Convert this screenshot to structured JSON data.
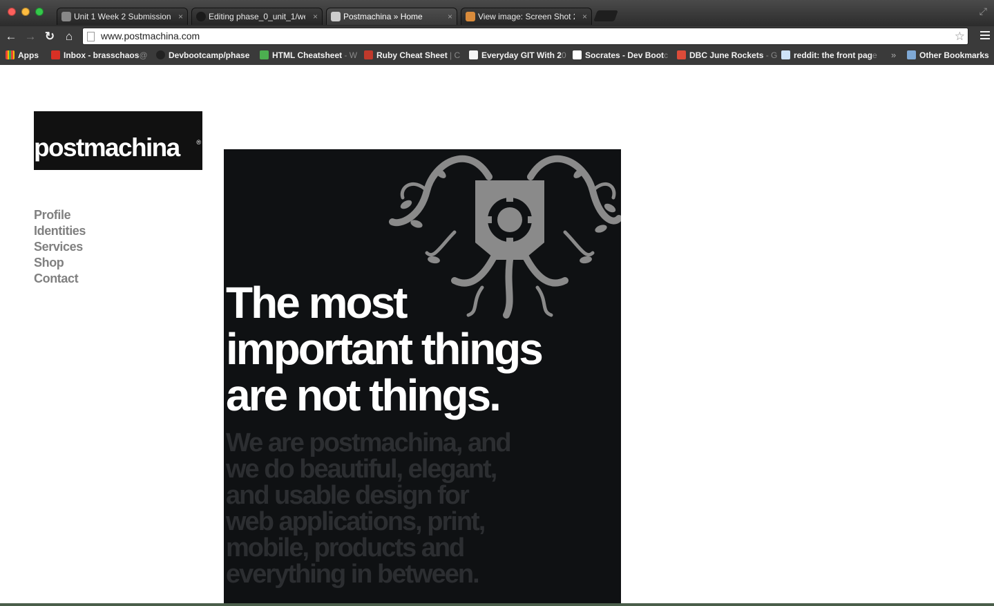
{
  "browser": {
    "tabs": [
      {
        "label": "Unit 1 Week 2 Submission",
        "favicon_color": "#888888",
        "active": false
      },
      {
        "label": "Editing phase_0_unit_1/we",
        "favicon_color": "#1a1a1a",
        "active": false
      },
      {
        "label": "Postmachina » Home",
        "favicon_color": "#cccccc",
        "active": true
      },
      {
        "label": "View image: Screen Shot 2",
        "favicon_color": "#d98b3b",
        "active": false
      }
    ],
    "tab_close_glyph": "×",
    "url": "www.postmachina.com",
    "bookmarks": [
      {
        "label": "Apps",
        "faded": "",
        "icon_color": "#e94235"
      },
      {
        "label": "Inbox - brasschaos",
        "faded": "@",
        "icon_color": "#d93025"
      },
      {
        "label": "Devbootcamp/phase",
        "faded": "",
        "icon_color": "#222222"
      },
      {
        "label": "HTML Cheatsheet",
        "faded": " - W",
        "icon_color": "#4caf50"
      },
      {
        "label": "Ruby Cheat Sheet",
        "faded": " | C",
        "icon_color": "#c0392b"
      },
      {
        "label": "Everyday GIT With 2",
        "faded": "0",
        "icon_color": "#f5f5f5"
      },
      {
        "label": "Socrates - Dev Boot",
        "faded": "c",
        "icon_color": "#ffffff"
      },
      {
        "label": "DBC June Rockets",
        "faded": " - G",
        "icon_color": "#dd4b39"
      },
      {
        "label": "reddit: the front pag",
        "faded": "e",
        "icon_color": "#cee3f8"
      }
    ],
    "bookmarks_more": "»",
    "other_bookmarks": "Other Bookmarks"
  },
  "site": {
    "logo": "postmachina",
    "logo_reg": "®",
    "nav": [
      "Profile",
      "Identities",
      "Services",
      "Shop",
      "Contact"
    ],
    "headline": [
      "The most",
      "important things",
      "are not things."
    ],
    "subtext": "We are postmachina, and we do beautiful, elegant, and usable design for web applications, print, mobile, products and everything in between.",
    "colors": {
      "hero_bg": "#0f1113",
      "emblem": "#8a8a8a",
      "nav": "#808080"
    }
  }
}
